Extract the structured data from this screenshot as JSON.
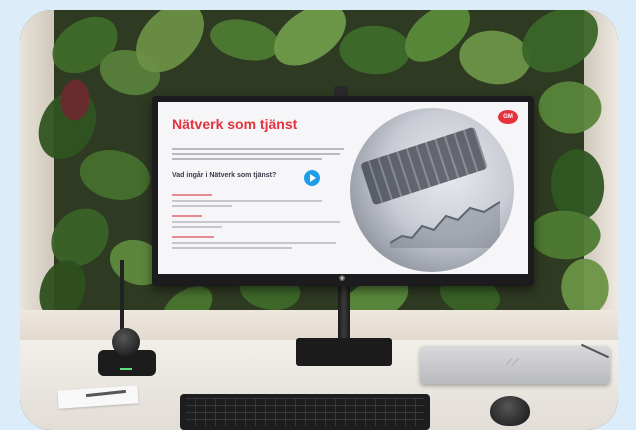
{
  "slide": {
    "title": "Nätverk som tjänst",
    "question": "Vad ingår i Nätverk som tjänst?",
    "logo_text": "GM"
  },
  "colors": {
    "slide_accent": "#e5323c",
    "play_button": "#1e9ee6"
  }
}
